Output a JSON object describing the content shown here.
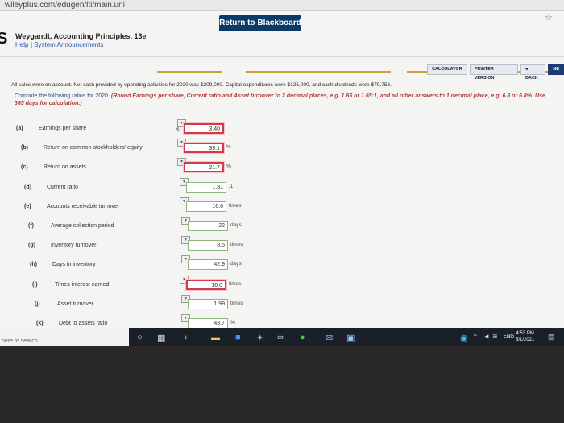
{
  "browser": {
    "url": "wileyplus.com/edugen/lti/main.uni"
  },
  "header": {
    "return_label": "Return to Blackboard",
    "logo_letter": "S",
    "book_title": "Weygandt, Accounting Principles, 13e",
    "help_link": "Help",
    "separator": "|",
    "announcements_link": "System Announcements"
  },
  "toolbar": {
    "calculator": "CALCULATOR",
    "printer": "PRINTER VERSION",
    "back": "◂ BACK",
    "next": "NE"
  },
  "problem": {
    "text": "All sales were on account. Net cash provided by operating activities for 2020 was $209,000. Capital expenditures were $125,000, and cash dividends were $79,756.",
    "instructions_plain": "Compute the following ratios for 2020.",
    "instructions_em": "(Round Earnings per share, Current ratio and Asset turnover to 2 decimal places, e.g. 1.65 or 1.65:1, and all other answers to 1 decimal place, e.g. 6.8 or 6.8%. Use 365 days for calculation.)"
  },
  "ratios": [
    {
      "letter": "(a)",
      "label": "Earnings per share",
      "value": "3.40",
      "prefix": "$",
      "unit": "",
      "status": "wrong"
    },
    {
      "letter": "(b)",
      "label": "Return on common stockholders' equity",
      "value": "39.1",
      "prefix": "",
      "unit": "%",
      "status": "wrong"
    },
    {
      "letter": "(c)",
      "label": "Return on assets",
      "value": "21.7",
      "prefix": "",
      "unit": "%",
      "status": "wrong"
    },
    {
      "letter": "(d)",
      "label": "Current ratio",
      "value": "1.81",
      "prefix": "",
      "unit": ":1",
      "status": "ok"
    },
    {
      "letter": "(e)",
      "label": "Accounts receivable turnover",
      "value": "16.6",
      "prefix": "",
      "unit": "times",
      "status": "ok"
    },
    {
      "letter": "(f)",
      "label": "Average collection period",
      "value": "22",
      "prefix": "",
      "unit": "days",
      "status": "ok"
    },
    {
      "letter": "(g)",
      "label": "Inventory turnover",
      "value": "8.5",
      "prefix": "",
      "unit": "times",
      "status": "ok"
    },
    {
      "letter": "(h)",
      "label": "Days in inventory",
      "value": "42.9",
      "prefix": "",
      "unit": "days",
      "status": "ok"
    },
    {
      "letter": "(i)",
      "label": "Times interest earned",
      "value": "16.0",
      "prefix": "",
      "unit": "times",
      "status": "wrong"
    },
    {
      "letter": "(j)",
      "label": "Asset turnover",
      "value": "1.99",
      "prefix": "",
      "unit": "times",
      "status": "ok"
    },
    {
      "letter": "(k)",
      "label": "Debt to assets ratio",
      "value": "43.7",
      "prefix": "",
      "unit": "%",
      "status": "ok"
    }
  ],
  "taskbar": {
    "search_placeholder": "here to search",
    "language": "ENG",
    "time": "4:53 PM",
    "date": "5/1/2021"
  },
  "colors": {
    "accent": "#0b3a66",
    "error": "#d4394a",
    "correct": "#8fb57c",
    "instruction": "#2a4f8e"
  }
}
